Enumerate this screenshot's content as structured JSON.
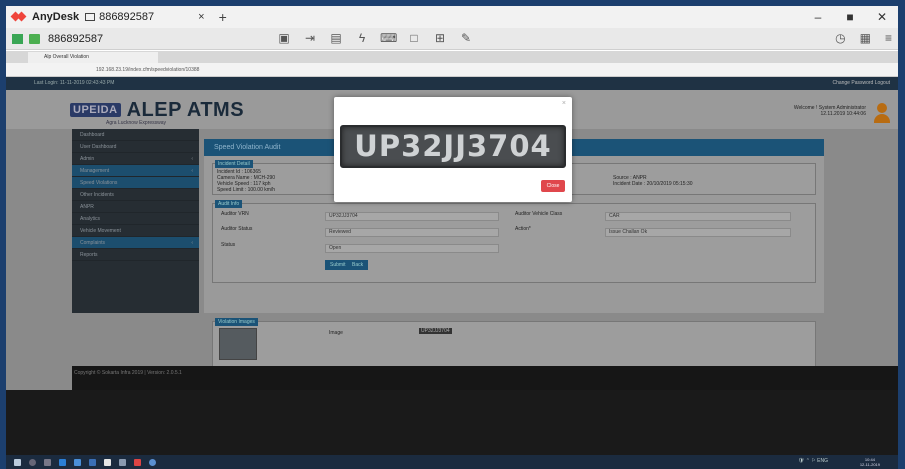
{
  "anydesk": {
    "app_name": "AnyDesk",
    "tab_id": "886892587",
    "tab_close": "×",
    "new_tab": "+",
    "window_controls": [
      "–",
      "■",
      "✕"
    ],
    "address": "886892587",
    "toolbar_icons": [
      "display-icon",
      "transfer-icon",
      "chat-icon",
      "actions-icon",
      "keyboard-icon",
      "screen-icon",
      "switch-icon",
      "draw-icon"
    ],
    "right_icons": [
      "history-icon",
      "menu-grid-icon",
      "menu-icon"
    ],
    "accent": "#ef443b"
  },
  "remote_browser": {
    "tab_title": "Alp Overall Violation",
    "url": "192.168.23.19/index.cfm/speedviolation/10388"
  },
  "web": {
    "top_left": "Last Login: 11-11-2019 02:43:43 PM",
    "top_right": "Change Password   Logout",
    "logo_badge": "UPEIDA",
    "logo_text": "ALEP ATMS",
    "logo_sub": "Agra Lucknow Expressway",
    "welcome_line1": "Welcome ! System Administrator",
    "welcome_line2": "12.11.2019 10:44:06",
    "sidebar": [
      {
        "label": "Dashboard",
        "caret": ""
      },
      {
        "label": "User Dashboard",
        "caret": ""
      },
      {
        "label": "Admin",
        "caret": "‹"
      },
      {
        "label": "Management",
        "caret": "‹"
      },
      {
        "label": "Speed Violations",
        "caret": ""
      },
      {
        "label": "Other Incidents",
        "caret": ""
      },
      {
        "label": "ANPR",
        "caret": ""
      },
      {
        "label": "Analytics",
        "caret": ""
      },
      {
        "label": "Vehicle Movement",
        "caret": ""
      },
      {
        "label": "Complaints",
        "caret": "‹"
      },
      {
        "label": "Reports",
        "caret": ""
      }
    ],
    "main_title": "Speed Violation Audit",
    "incident_legend": "Incident Detail",
    "incident_lines": [
      "Incident Id : 106365",
      "Camera Name : MCH-290",
      "Vehicle Speed : 117 kph",
      "Speed Limit : 100.00 km/h"
    ],
    "incident_right": [
      "Source : ANPR",
      "Incident Date : 20/10/2019 05:15:30"
    ],
    "audit_legend": "Audit Info",
    "audit_vrn_label": "Auditor VRN",
    "audit_vrn_value": "UP32JJ3704",
    "audit_status_label": "Auditor Status",
    "audit_status_value": "Reviewed",
    "audit_status_label2": "Status",
    "audit_status_value2": "Open",
    "vehicle_class_label": "Auditor Vehicle Class",
    "vehicle_class_value": "CAR",
    "action_label": "Action*",
    "action_value": "Issue Challan Ok",
    "submit_label": "Submit",
    "back_label": "Back",
    "images_legend": "Violation Images",
    "image_label": "Image",
    "plate_small": "UP32JJ3704",
    "footer": "Copyright © Sokarta Infra 2019 | Version: 2.0.5.1"
  },
  "modal": {
    "close_x": "×",
    "plate_text": "UP32JJ3704",
    "close_label": "Close"
  },
  "taskbar": {
    "tray": "🛡 ⌃ ⚐ ENG",
    "clock_time": "10:44",
    "clock_date": "12-11-2019"
  }
}
